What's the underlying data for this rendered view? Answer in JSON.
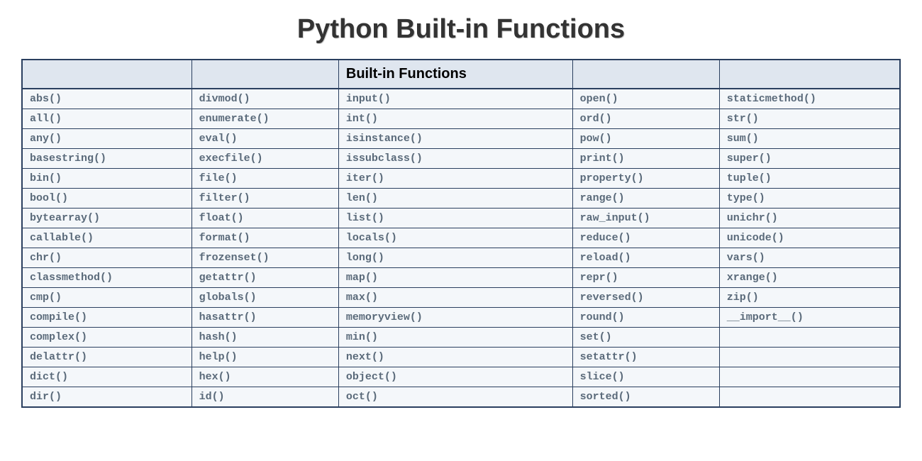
{
  "title": "Python Built-in Functions",
  "header": {
    "columns": [
      "",
      "",
      "Built-in Functions",
      "",
      ""
    ]
  },
  "rows": [
    [
      "abs()",
      "divmod()",
      "input()",
      "open()",
      "staticmethod()"
    ],
    [
      "all()",
      "enumerate()",
      "int()",
      "ord()",
      "str()"
    ],
    [
      "any()",
      "eval()",
      "isinstance()",
      "pow()",
      "sum()"
    ],
    [
      "basestring()",
      "execfile()",
      "issubclass()",
      "print()",
      "super()"
    ],
    [
      "bin()",
      "file()",
      "iter()",
      "property()",
      "tuple()"
    ],
    [
      "bool()",
      "filter()",
      "len()",
      "range()",
      "type()"
    ],
    [
      "bytearray()",
      "float()",
      "list()",
      "raw_input()",
      "unichr()"
    ],
    [
      "callable()",
      "format()",
      "locals()",
      "reduce()",
      "unicode()"
    ],
    [
      "chr()",
      "frozenset()",
      "long()",
      "reload()",
      "vars()"
    ],
    [
      "classmethod()",
      "getattr()",
      "map()",
      "repr()",
      "xrange()"
    ],
    [
      "cmp()",
      "globals()",
      "max()",
      "reversed()",
      "zip()"
    ],
    [
      "compile()",
      "hasattr()",
      "memoryview()",
      "round()",
      "__import__()"
    ],
    [
      "complex()",
      "hash()",
      "min()",
      "set()",
      ""
    ],
    [
      "delattr()",
      "help()",
      "next()",
      "setattr()",
      ""
    ],
    [
      "dict()",
      "hex()",
      "object()",
      "slice()",
      ""
    ],
    [
      "dir()",
      "id()",
      "oct()",
      "sorted()",
      ""
    ]
  ]
}
